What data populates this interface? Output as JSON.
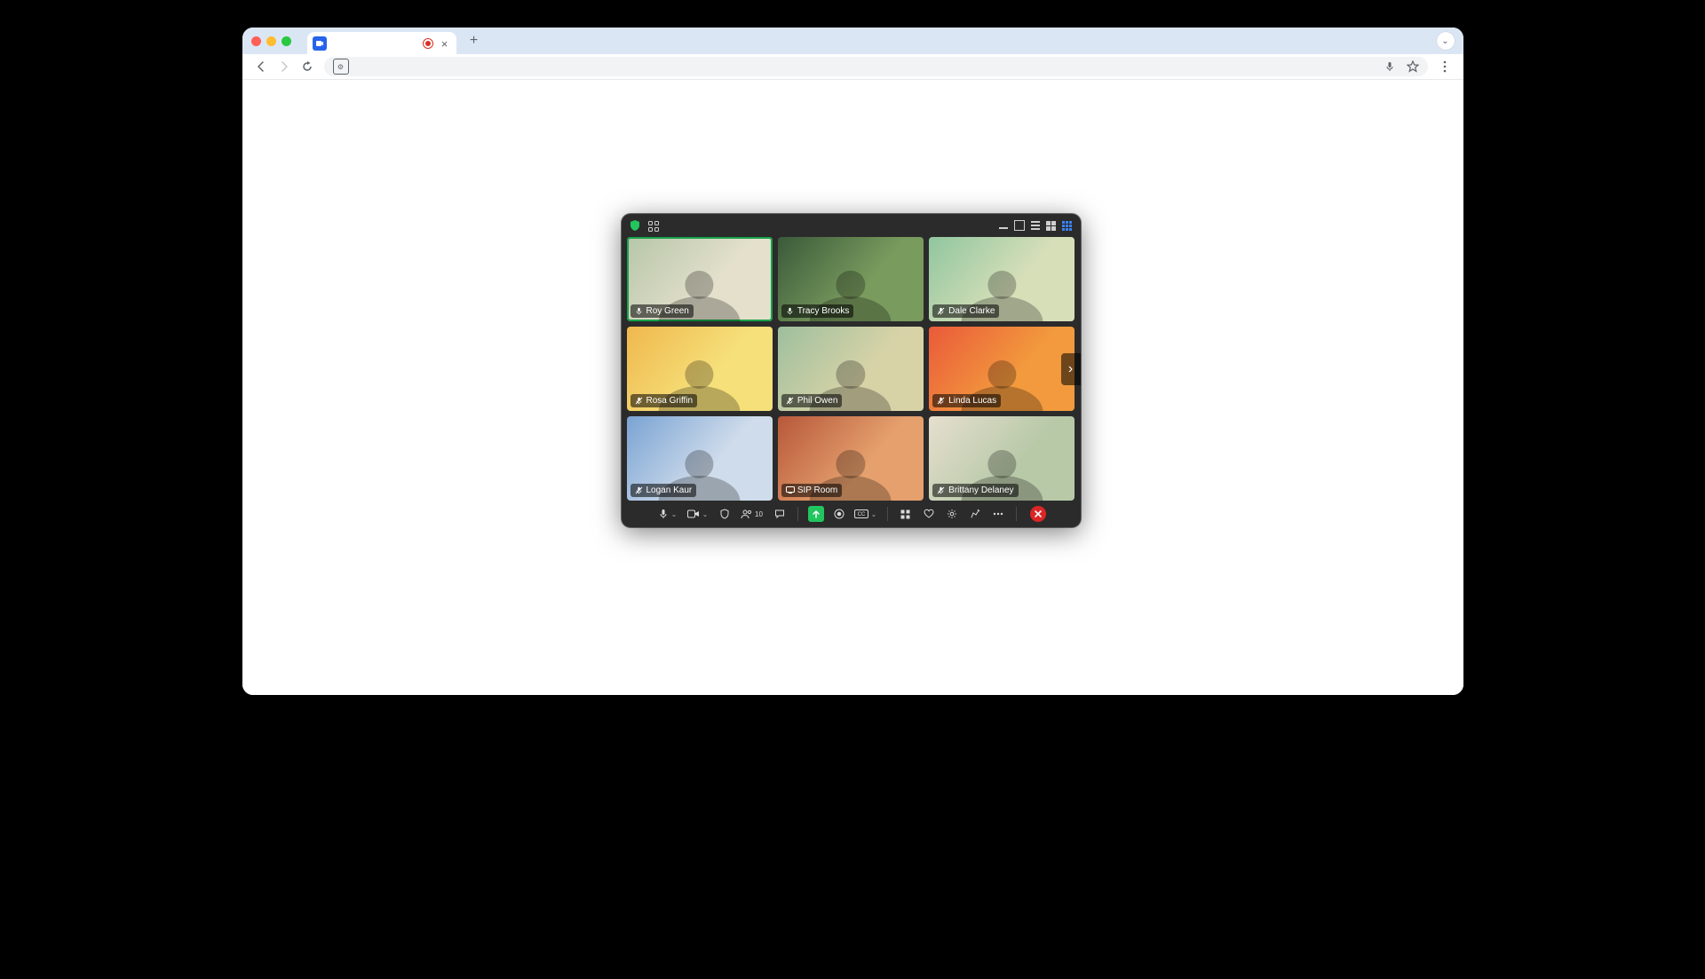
{
  "browser": {
    "tab_title": "",
    "plus": "+",
    "close": "×",
    "dropdown": "⌄"
  },
  "video_window": {
    "participant_count": "10",
    "participants": [
      {
        "name": "Roy Green",
        "mic_state": "unmuted",
        "speaking": true,
        "bg": "bg-a",
        "tag_icon": "mic"
      },
      {
        "name": "Tracy Brooks",
        "mic_state": "unmuted",
        "speaking": false,
        "bg": "bg-b",
        "tag_icon": "mic"
      },
      {
        "name": "Dale Clarke",
        "mic_state": "muted",
        "speaking": false,
        "bg": "bg-c",
        "tag_icon": "mic-muted"
      },
      {
        "name": "Rosa Griffin",
        "mic_state": "muted",
        "speaking": false,
        "bg": "bg-d",
        "tag_icon": "mic-muted"
      },
      {
        "name": "Phil Owen",
        "mic_state": "muted",
        "speaking": false,
        "bg": "bg-e",
        "tag_icon": "mic-muted"
      },
      {
        "name": "Linda Lucas",
        "mic_state": "muted",
        "speaking": false,
        "bg": "bg-f",
        "tag_icon": "mic-muted"
      },
      {
        "name": "Logan Kaur",
        "mic_state": "muted",
        "speaking": false,
        "bg": "bg-g",
        "tag_icon": "mic-muted"
      },
      {
        "name": "SIP Room",
        "mic_state": "room",
        "speaking": false,
        "bg": "bg-h",
        "tag_icon": "room"
      },
      {
        "name": "Brittany Delaney",
        "mic_state": "muted",
        "speaking": false,
        "bg": "bg-i",
        "tag_icon": "mic-muted"
      }
    ],
    "toolbar": {
      "mic": "microphone",
      "camera": "camera",
      "security": "security",
      "participants": "participants",
      "chat": "chat",
      "share": "share-screen",
      "record": "record",
      "cc": "CC",
      "apps": "apps",
      "reactions": "reactions",
      "settings": "settings",
      "whiteboard": "whiteboard",
      "more": "more",
      "end": "end-call"
    },
    "top": {
      "shield": "encryption-shield",
      "apps": "gallery-apps",
      "minimize": "minimize",
      "view_single": "single-view",
      "view_rows": "row-view",
      "view_2x2": "2x2-view",
      "view_3x3": "3x3-view"
    },
    "next": "›"
  }
}
